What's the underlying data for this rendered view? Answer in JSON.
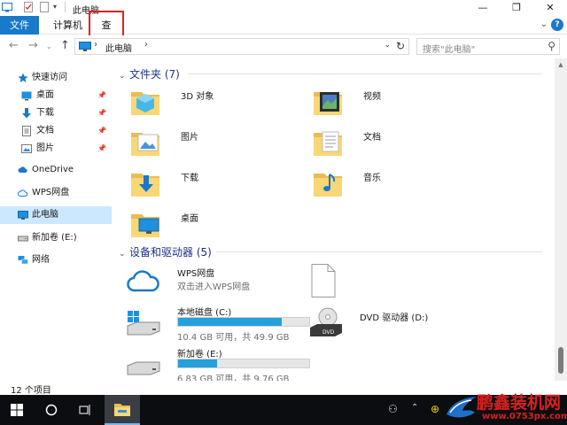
{
  "window": {
    "title": "此电脑",
    "minimize_glyph": "—",
    "maximize_glyph": "❐",
    "close_glyph": "✕"
  },
  "ribbon": {
    "tabs": [
      {
        "label": "文件",
        "active_color": "#1979ca"
      },
      {
        "label": "计算机"
      },
      {
        "label": "查看",
        "highlighted": true
      }
    ],
    "help_glyph": "?"
  },
  "address": {
    "path": "此电脑",
    "search_placeholder": "搜索\"此电脑\""
  },
  "navigation": {
    "items": [
      {
        "label": "快速访问",
        "icon": "star-icon"
      },
      {
        "label": "桌面",
        "icon": "desktop-icon",
        "pinned": true
      },
      {
        "label": "下载",
        "icon": "download-icon",
        "pinned": true
      },
      {
        "label": "文档",
        "icon": "document-icon",
        "pinned": true
      },
      {
        "label": "图片",
        "icon": "picture-icon",
        "pinned": true
      },
      {
        "label": "OneDrive",
        "icon": "cloud-icon"
      },
      {
        "label": "WPS网盘",
        "icon": "wps-cloud-icon"
      },
      {
        "label": "此电脑",
        "icon": "computer-icon",
        "selected": true
      },
      {
        "label": "新加卷 (E:)",
        "icon": "drive-icon"
      },
      {
        "label": "网络",
        "icon": "network-icon"
      }
    ]
  },
  "folders_section": {
    "heading": "文件夹 (7)",
    "folders": [
      {
        "label": "3D 对象",
        "icon": "3d-objects-folder-icon"
      },
      {
        "label": "视频",
        "icon": "videos-folder-icon"
      },
      {
        "label": "图片",
        "icon": "pictures-folder-icon"
      },
      {
        "label": "文档",
        "icon": "documents-folder-icon"
      },
      {
        "label": "下载",
        "icon": "downloads-folder-icon"
      },
      {
        "label": "音乐",
        "icon": "music-folder-icon"
      },
      {
        "label": "桌面",
        "icon": "desktop-folder-icon"
      }
    ]
  },
  "devices_section": {
    "heading": "设备和驱动器 (5)",
    "devices": [
      {
        "name": "WPS网盘",
        "subtitle": "双击进入WPS网盘",
        "icon": "wps-cloud-drive-icon"
      },
      {
        "name": "",
        "icon": "blank-file-icon"
      },
      {
        "name": "本地磁盘 (C:)",
        "usage": "10.4 GB 可用，共 49.9 GB",
        "used_fraction": 0.79,
        "icon": "local-disk-icon"
      },
      {
        "name": "DVD 驱动器 (D:)",
        "icon": "dvd-drive-icon"
      },
      {
        "name": "新加卷 (E:)",
        "usage": "6.83 GB 可用，共 9.76 GB",
        "used_fraction": 0.3,
        "icon": "drive-icon"
      }
    ]
  },
  "status": {
    "item_count": "12 个项目"
  },
  "watermark": {
    "title": "鹏鑫装机网",
    "url": "www.0753px.com"
  },
  "colors": {
    "accent": "#1979ca",
    "selection": "#cce8ff",
    "bar_fill": "#26a0da",
    "highlight_box": "#e02020"
  }
}
